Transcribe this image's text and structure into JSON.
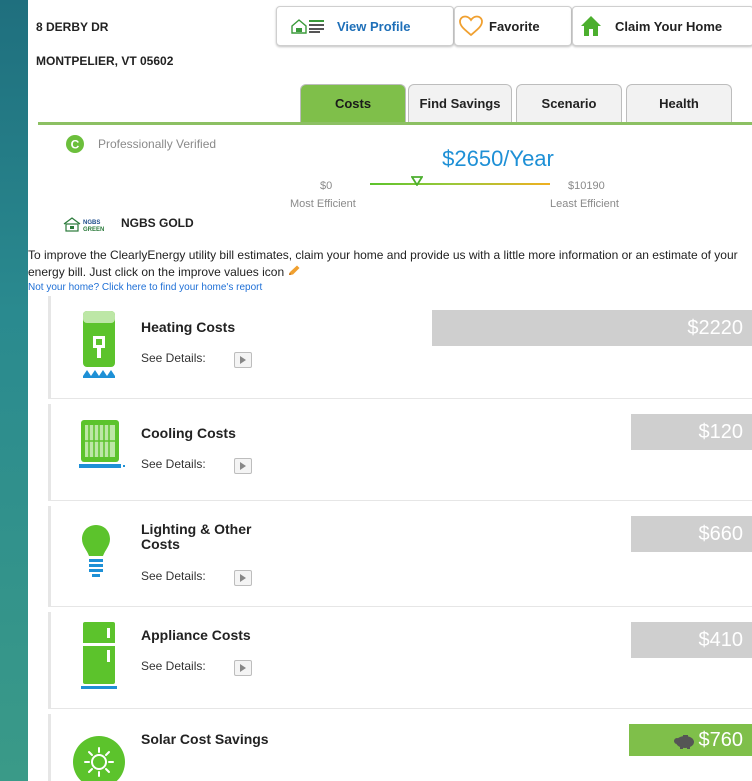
{
  "address": {
    "street": "8 DERBY DR",
    "city_state_zip": "MONTPELIER, VT 05602"
  },
  "top_buttons": [
    {
      "label": "View Profile",
      "icon": "vermont-home-energy-profile-logo"
    },
    {
      "label": "Favorite",
      "icon": "heart-icon"
    },
    {
      "label": "Claim Your Home",
      "icon": "house-icon"
    }
  ],
  "tabs": [
    {
      "label": "Costs",
      "active": true
    },
    {
      "label": "Find Savings",
      "active": false
    },
    {
      "label": "Scenario",
      "active": false
    },
    {
      "label": "Health",
      "active": false
    }
  ],
  "verified": {
    "label": "Professionally Verified",
    "icon": "c-badge-icon"
  },
  "annual_cost": {
    "value": "$2650/Year",
    "min_label": "$0",
    "max_label": "$10190",
    "min_caption": "Most Efficient",
    "max_caption": "Least Efficient",
    "position_fraction": 0.26
  },
  "certification": {
    "label": "NGBS GOLD",
    "logo_text": "NGBS GREEN"
  },
  "info": {
    "text": "To improve the ClearlyEnergy utility bill estimates, claim your home and provide us with a little more information or an estimate of your energy bill. Just click on the improve values icon",
    "link": "Not your home? Click here to find your home's report"
  },
  "see_details_label": "See Details:",
  "cost_rows": [
    {
      "title": "Heating Costs",
      "value": "$2220",
      "fraction": 0.218,
      "icon": "water-heater-icon"
    },
    {
      "title": "Cooling Costs",
      "value": "$120",
      "fraction": 0.012,
      "icon": "air-conditioner-icon"
    },
    {
      "title": "Lighting & Other Costs",
      "value": "$660",
      "fraction": 0.065,
      "icon": "light-bulb-icon"
    },
    {
      "title": "Appliance Costs",
      "value": "$410",
      "fraction": 0.04,
      "icon": "refrigerator-icon"
    }
  ],
  "solar": {
    "title": "Solar Cost Savings",
    "value": "$760",
    "icon": "sun-icon",
    "badge_icon": "piggy-bank-icon"
  },
  "colors": {
    "green": "#7fbf4a",
    "blue": "#1e90d6",
    "gray_bar": "#cfcfcf",
    "icon_green": "#5cc32c"
  }
}
